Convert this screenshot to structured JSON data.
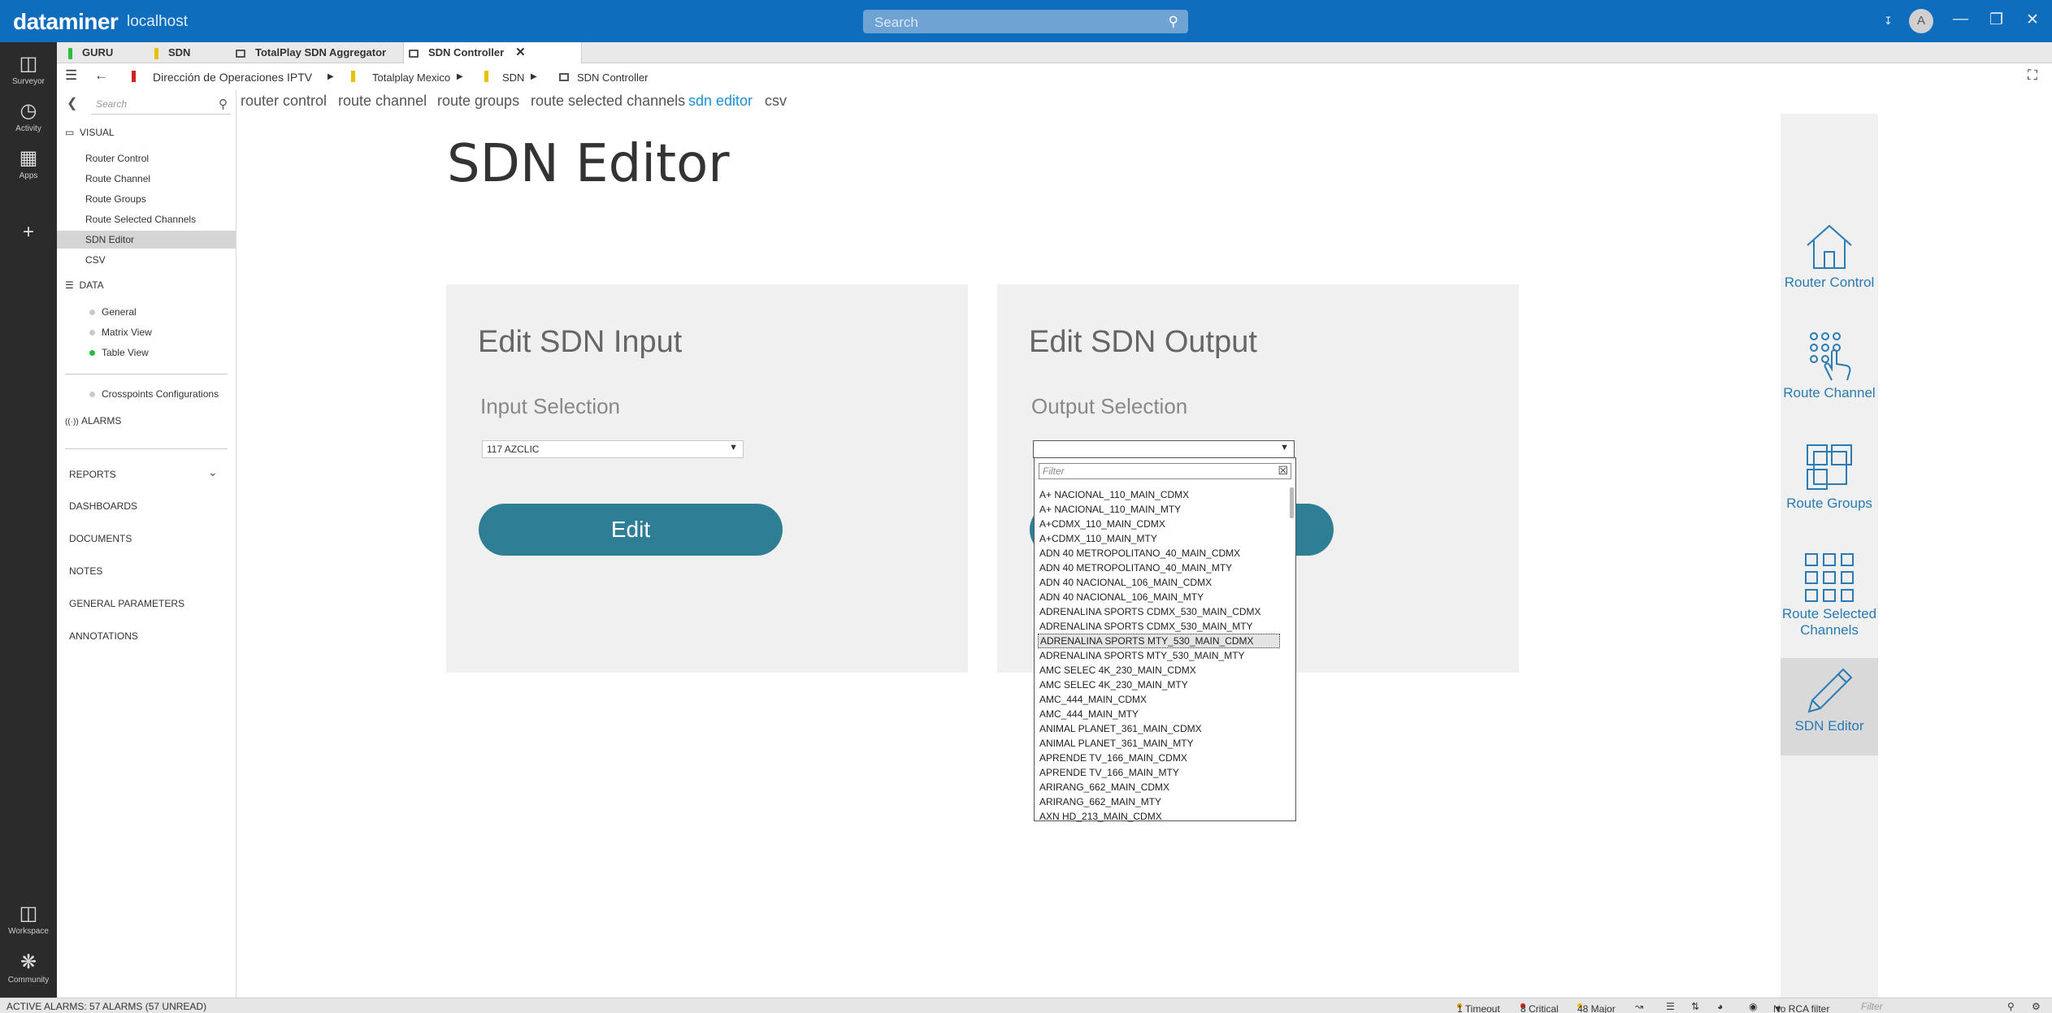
{
  "app": {
    "logo": "dataminer",
    "host": "localhost",
    "search_placeholder": "Search",
    "user_initial": "A"
  },
  "rail": [
    {
      "label": "Surveyor",
      "icon": "surveyor-icon"
    },
    {
      "label": "Activity",
      "icon": "activity-icon"
    },
    {
      "label": "Apps",
      "icon": "apps-icon"
    },
    {
      "label": "Workspace",
      "icon": "workspace-icon"
    },
    {
      "label": "Community",
      "icon": "community-icon"
    }
  ],
  "tabs": [
    {
      "label": "GURU",
      "color": "#2bbd3c"
    },
    {
      "label": "SDN",
      "color": "#e6c200"
    },
    {
      "label": "TotalPlay SDN Aggregator",
      "color": "#555555"
    },
    {
      "label": "SDN Controller",
      "color": "#555555",
      "active": true
    }
  ],
  "breadcrumb": [
    "Dirección de Operaciones IPTV",
    "Totalplay Mexico",
    "SDN",
    "SDN Controller"
  ],
  "leftnav": {
    "search_placeholder": "Search",
    "visual_header": "VISUAL",
    "visual_items": [
      "Router Control",
      "Route Channel",
      "Route Groups",
      "Route Selected Channels",
      "SDN Editor",
      "CSV"
    ],
    "data_header": "DATA",
    "data_items": [
      "General",
      "Matrix View",
      "Table View"
    ],
    "crosspoints": "Crosspoints Configurations",
    "alarms": "ALARMS",
    "lower": [
      "REPORTS",
      "DASHBOARDS",
      "DOCUMENTS",
      "NOTES",
      "GENERAL PARAMETERS",
      "ANNOTATIONS"
    ]
  },
  "subnav": [
    "router control",
    "route channel",
    "route groups",
    "route selected channels",
    "sdn editor",
    "csv"
  ],
  "page_title": "SDN Editor",
  "input_panel": {
    "title": "Edit SDN Input",
    "selection_label": "Input Selection",
    "selected_value": "117 AZCLIC",
    "button": "Edit"
  },
  "output_panel": {
    "title": "Edit SDN Output",
    "selection_label": "Output Selection",
    "selected_value": "",
    "filter_placeholder": "Filter",
    "options": [
      "A+ NACIONAL_110_MAIN_CDMX",
      "A+ NACIONAL_110_MAIN_MTY",
      "A+CDMX_110_MAIN_CDMX",
      "A+CDMX_110_MAIN_MTY",
      "ADN 40 METROPOLITANO_40_MAIN_CDMX",
      "ADN 40 METROPOLITANO_40_MAIN_MTY",
      "ADN 40 NACIONAL_106_MAIN_CDMX",
      "ADN 40 NACIONAL_106_MAIN_MTY",
      "ADRENALINA SPORTS CDMX_530_MAIN_CDMX",
      "ADRENALINA SPORTS CDMX_530_MAIN_MTY",
      "ADRENALINA SPORTS MTY_530_MAIN_CDMX",
      "ADRENALINA SPORTS MTY_530_MAIN_MTY",
      "AMC SELEC 4K_230_MAIN_CDMX",
      "AMC SELEC 4K_230_MAIN_MTY",
      "AMC_444_MAIN_CDMX",
      "AMC_444_MAIN_MTY",
      "ANIMAL PLANET_361_MAIN_CDMX",
      "ANIMAL PLANET_361_MAIN_MTY",
      "APRENDE TV_166_MAIN_CDMX",
      "APRENDE TV_166_MAIN_MTY",
      "ARIRANG_662_MAIN_CDMX",
      "ARIRANG_662_MAIN_MTY",
      "AXN HD_213_MAIN_CDMX"
    ],
    "hover_index": 10
  },
  "right_panel": [
    {
      "label": "Router Control",
      "icon": "home-icon"
    },
    {
      "label": "Route Channel",
      "icon": "keypad-hand-icon"
    },
    {
      "label": "Route Groups",
      "icon": "overlapping-squares-icon"
    },
    {
      "label": "Route Selected Channels",
      "icon": "grid-icon"
    },
    {
      "label": "SDN Editor",
      "icon": "pencil-icon",
      "active": true
    }
  ],
  "statusbar": {
    "active_alarms": "ACTIVE ALARMS: 57 ALARMS (57 UNREAD)",
    "timeout": "1 Timeout",
    "critical": "8 Critical",
    "major": "48 Major",
    "rca": "No RCA filter",
    "filter_placeholder": "Filter"
  },
  "colors": {
    "titlebar": "#0f6dbd",
    "button": "#2e7f96",
    "accent_link": "#1a8fd6",
    "right_panel_icons": "#2a7ab3",
    "timeout": "#f0a000",
    "critical": "#e02020",
    "major": "#f0c000"
  }
}
